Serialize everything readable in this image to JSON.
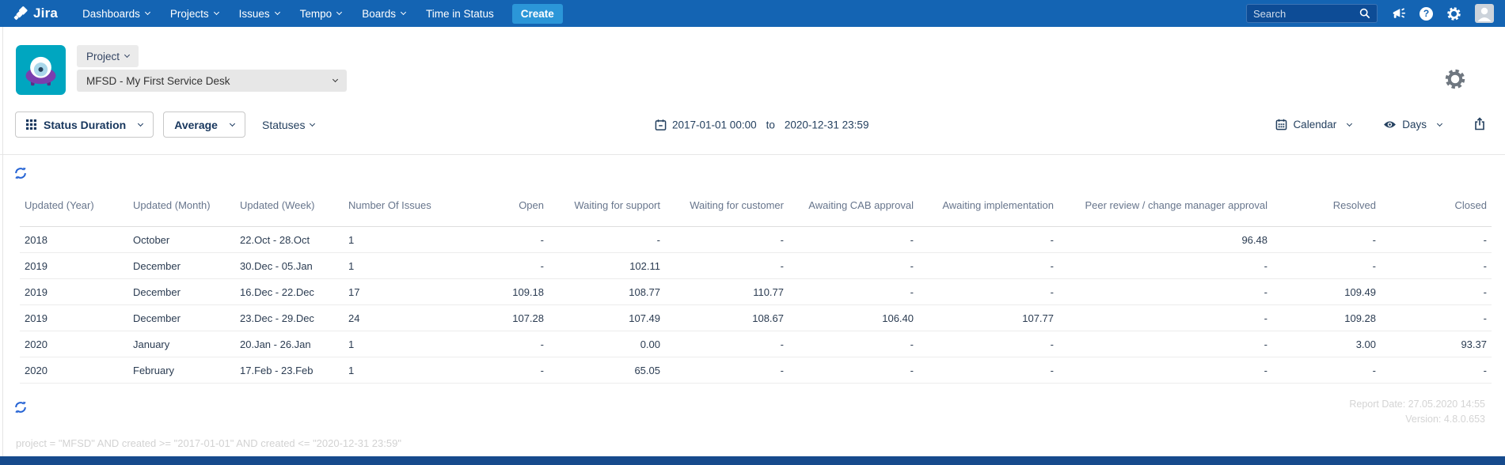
{
  "navbar": {
    "logo": "Jira",
    "items": [
      {
        "label": "Dashboards",
        "has_menu": true
      },
      {
        "label": "Projects",
        "has_menu": true
      },
      {
        "label": "Issues",
        "has_menu": true
      },
      {
        "label": "Tempo",
        "has_menu": true
      },
      {
        "label": "Boards",
        "has_menu": true
      },
      {
        "label": "Time in Status",
        "has_menu": false
      }
    ],
    "create_label": "Create",
    "search_placeholder": "Search"
  },
  "header": {
    "project_button": "Project",
    "project_select": "MFSD - My First Service Desk"
  },
  "toolbar": {
    "report_type": "Status Duration",
    "metric": "Average",
    "statuses_label": "Statuses",
    "date_from": "2017-01-01 00:00",
    "date_separator": "to",
    "date_to": "2020-12-31 23:59",
    "calendar_label": "Calendar",
    "unit_label": "Days"
  },
  "table": {
    "columns": [
      "Updated (Year)",
      "Updated (Month)",
      "Updated (Week)",
      "Number Of Issues",
      "Open",
      "Waiting for support",
      "Waiting for customer",
      "Awaiting CAB approval",
      "Awaiting implementation",
      "Peer review / change manager approval",
      "Resolved",
      "Closed"
    ],
    "rows": [
      [
        "2018",
        "October",
        "22.Oct - 28.Oct",
        "1",
        "-",
        "-",
        "-",
        "-",
        "-",
        "96.48",
        "-",
        "-"
      ],
      [
        "2019",
        "December",
        "30.Dec - 05.Jan",
        "1",
        "-",
        "102.11",
        "-",
        "-",
        "-",
        "-",
        "-",
        "-"
      ],
      [
        "2019",
        "December",
        "16.Dec - 22.Dec",
        "17",
        "109.18",
        "108.77",
        "110.77",
        "-",
        "-",
        "-",
        "109.49",
        "-"
      ],
      [
        "2019",
        "December",
        "23.Dec - 29.Dec",
        "24",
        "107.28",
        "107.49",
        "108.67",
        "106.40",
        "107.77",
        "-",
        "109.28",
        "-"
      ],
      [
        "2020",
        "January",
        "20.Jan - 26.Jan",
        "1",
        "-",
        "0.00",
        "-",
        "-",
        "-",
        "-",
        "3.00",
        "93.37"
      ],
      [
        "2020",
        "February",
        "17.Feb - 23.Feb",
        "1",
        "-",
        "65.05",
        "-",
        "-",
        "-",
        "-",
        "-",
        "-"
      ]
    ]
  },
  "footer": {
    "jql": "project = \"MFSD\" AND created >= \"2017-01-01\" AND created <= \"2020-12-31 23:59\"",
    "report_date": "Report Date: 27.05.2020 14:55",
    "version": "Version: 4.8.0.653"
  },
  "colors": {
    "navbar_blue": "#1464b3",
    "create_blue": "#2b96d8",
    "refresh_blue": "#2563d4",
    "project_avatar_teal": "#00a6c0",
    "project_avatar_purple": "#7b3fae"
  }
}
